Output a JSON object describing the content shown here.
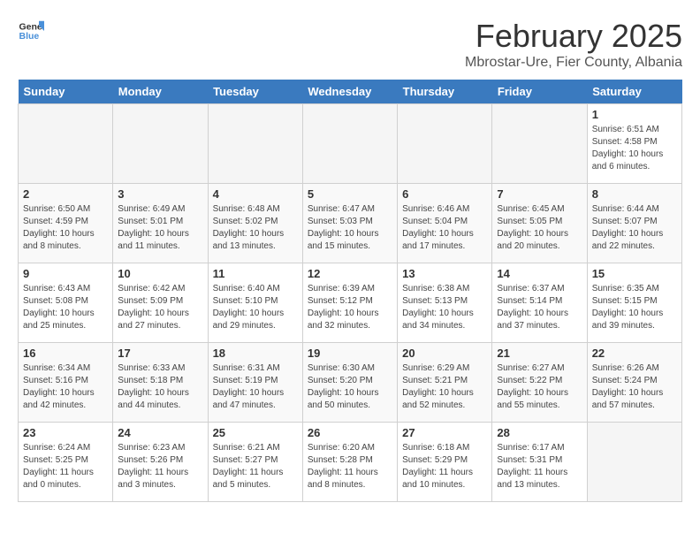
{
  "logo": {
    "general": "General",
    "blue": "Blue"
  },
  "title": "February 2025",
  "location": "Mbrostar-Ure, Fier County, Albania",
  "days_of_week": [
    "Sunday",
    "Monday",
    "Tuesday",
    "Wednesday",
    "Thursday",
    "Friday",
    "Saturday"
  ],
  "weeks": [
    [
      {
        "day": "",
        "info": "",
        "empty": true
      },
      {
        "day": "",
        "info": "",
        "empty": true
      },
      {
        "day": "",
        "info": "",
        "empty": true
      },
      {
        "day": "",
        "info": "",
        "empty": true
      },
      {
        "day": "",
        "info": "",
        "empty": true
      },
      {
        "day": "",
        "info": "",
        "empty": true
      },
      {
        "day": "1",
        "info": "Sunrise: 6:51 AM\nSunset: 4:58 PM\nDaylight: 10 hours and 6 minutes.",
        "empty": false
      }
    ],
    [
      {
        "day": "2",
        "info": "Sunrise: 6:50 AM\nSunset: 4:59 PM\nDaylight: 10 hours and 8 minutes.",
        "empty": false
      },
      {
        "day": "3",
        "info": "Sunrise: 6:49 AM\nSunset: 5:01 PM\nDaylight: 10 hours and 11 minutes.",
        "empty": false
      },
      {
        "day": "4",
        "info": "Sunrise: 6:48 AM\nSunset: 5:02 PM\nDaylight: 10 hours and 13 minutes.",
        "empty": false
      },
      {
        "day": "5",
        "info": "Sunrise: 6:47 AM\nSunset: 5:03 PM\nDaylight: 10 hours and 15 minutes.",
        "empty": false
      },
      {
        "day": "6",
        "info": "Sunrise: 6:46 AM\nSunset: 5:04 PM\nDaylight: 10 hours and 17 minutes.",
        "empty": false
      },
      {
        "day": "7",
        "info": "Sunrise: 6:45 AM\nSunset: 5:05 PM\nDaylight: 10 hours and 20 minutes.",
        "empty": false
      },
      {
        "day": "8",
        "info": "Sunrise: 6:44 AM\nSunset: 5:07 PM\nDaylight: 10 hours and 22 minutes.",
        "empty": false
      }
    ],
    [
      {
        "day": "9",
        "info": "Sunrise: 6:43 AM\nSunset: 5:08 PM\nDaylight: 10 hours and 25 minutes.",
        "empty": false
      },
      {
        "day": "10",
        "info": "Sunrise: 6:42 AM\nSunset: 5:09 PM\nDaylight: 10 hours and 27 minutes.",
        "empty": false
      },
      {
        "day": "11",
        "info": "Sunrise: 6:40 AM\nSunset: 5:10 PM\nDaylight: 10 hours and 29 minutes.",
        "empty": false
      },
      {
        "day": "12",
        "info": "Sunrise: 6:39 AM\nSunset: 5:12 PM\nDaylight: 10 hours and 32 minutes.",
        "empty": false
      },
      {
        "day": "13",
        "info": "Sunrise: 6:38 AM\nSunset: 5:13 PM\nDaylight: 10 hours and 34 minutes.",
        "empty": false
      },
      {
        "day": "14",
        "info": "Sunrise: 6:37 AM\nSunset: 5:14 PM\nDaylight: 10 hours and 37 minutes.",
        "empty": false
      },
      {
        "day": "15",
        "info": "Sunrise: 6:35 AM\nSunset: 5:15 PM\nDaylight: 10 hours and 39 minutes.",
        "empty": false
      }
    ],
    [
      {
        "day": "16",
        "info": "Sunrise: 6:34 AM\nSunset: 5:16 PM\nDaylight: 10 hours and 42 minutes.",
        "empty": false
      },
      {
        "day": "17",
        "info": "Sunrise: 6:33 AM\nSunset: 5:18 PM\nDaylight: 10 hours and 44 minutes.",
        "empty": false
      },
      {
        "day": "18",
        "info": "Sunrise: 6:31 AM\nSunset: 5:19 PM\nDaylight: 10 hours and 47 minutes.",
        "empty": false
      },
      {
        "day": "19",
        "info": "Sunrise: 6:30 AM\nSunset: 5:20 PM\nDaylight: 10 hours and 50 minutes.",
        "empty": false
      },
      {
        "day": "20",
        "info": "Sunrise: 6:29 AM\nSunset: 5:21 PM\nDaylight: 10 hours and 52 minutes.",
        "empty": false
      },
      {
        "day": "21",
        "info": "Sunrise: 6:27 AM\nSunset: 5:22 PM\nDaylight: 10 hours and 55 minutes.",
        "empty": false
      },
      {
        "day": "22",
        "info": "Sunrise: 6:26 AM\nSunset: 5:24 PM\nDaylight: 10 hours and 57 minutes.",
        "empty": false
      }
    ],
    [
      {
        "day": "23",
        "info": "Sunrise: 6:24 AM\nSunset: 5:25 PM\nDaylight: 11 hours and 0 minutes.",
        "empty": false
      },
      {
        "day": "24",
        "info": "Sunrise: 6:23 AM\nSunset: 5:26 PM\nDaylight: 11 hours and 3 minutes.",
        "empty": false
      },
      {
        "day": "25",
        "info": "Sunrise: 6:21 AM\nSunset: 5:27 PM\nDaylight: 11 hours and 5 minutes.",
        "empty": false
      },
      {
        "day": "26",
        "info": "Sunrise: 6:20 AM\nSunset: 5:28 PM\nDaylight: 11 hours and 8 minutes.",
        "empty": false
      },
      {
        "day": "27",
        "info": "Sunrise: 6:18 AM\nSunset: 5:29 PM\nDaylight: 11 hours and 10 minutes.",
        "empty": false
      },
      {
        "day": "28",
        "info": "Sunrise: 6:17 AM\nSunset: 5:31 PM\nDaylight: 11 hours and 13 minutes.",
        "empty": false
      },
      {
        "day": "",
        "info": "",
        "empty": true
      }
    ]
  ]
}
